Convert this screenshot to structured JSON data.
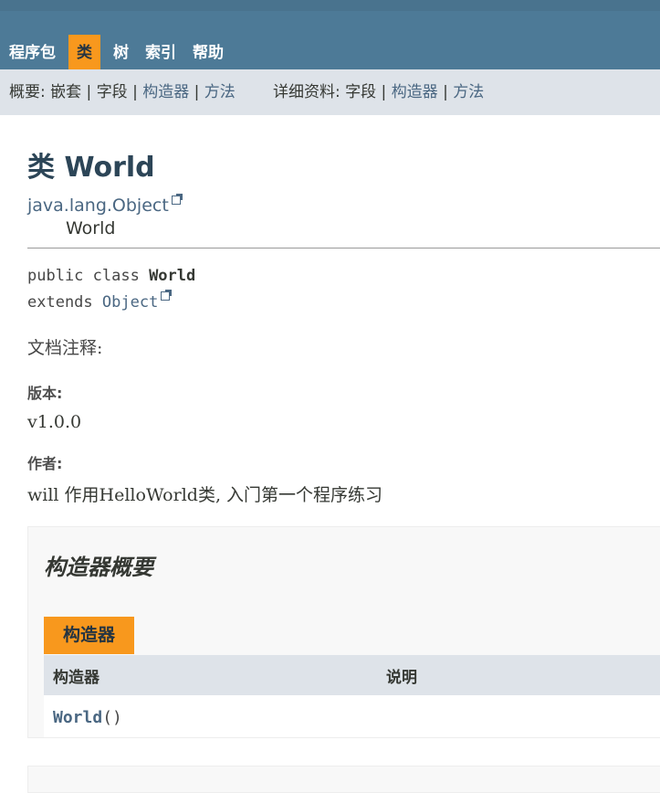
{
  "nav": {
    "items": [
      "程序包",
      "类",
      "树",
      "索引",
      "帮助"
    ],
    "active_index": 1
  },
  "subnav": {
    "summary_label": "概要:",
    "summary_nested": "嵌套",
    "summary_field": "字段",
    "summary_constructor": "构造器",
    "summary_method": "方法",
    "detail_label": "详细资料:",
    "detail_field": "字段",
    "detail_constructor": "构造器",
    "detail_method": "方法",
    "separator": "|"
  },
  "page": {
    "title": "类 World",
    "inheritance_parent": "java.lang.Object",
    "inheritance_child": "World",
    "sig_modifiers": "public class ",
    "sig_class": "World",
    "sig_extends": "extends ",
    "sig_super": "Object",
    "doc_comment": "文档注释:",
    "version_label": "版本:",
    "version_value": "v1.0.0",
    "author_label": "作者:",
    "author_value": "will 作用HelloWorld类, 入门第一个程序练习"
  },
  "constructor_summary": {
    "heading": "构造器概要",
    "caption": "构造器",
    "col_constructor": "构造器",
    "col_description": "说明",
    "rows": [
      {
        "name": "World",
        "suffix": "()"
      }
    ]
  },
  "colors": {
    "nav_bg": "#4d7a97",
    "active_tab": "#f8981d",
    "subnav_bg": "#dee3e9",
    "link": "#4a6782"
  }
}
